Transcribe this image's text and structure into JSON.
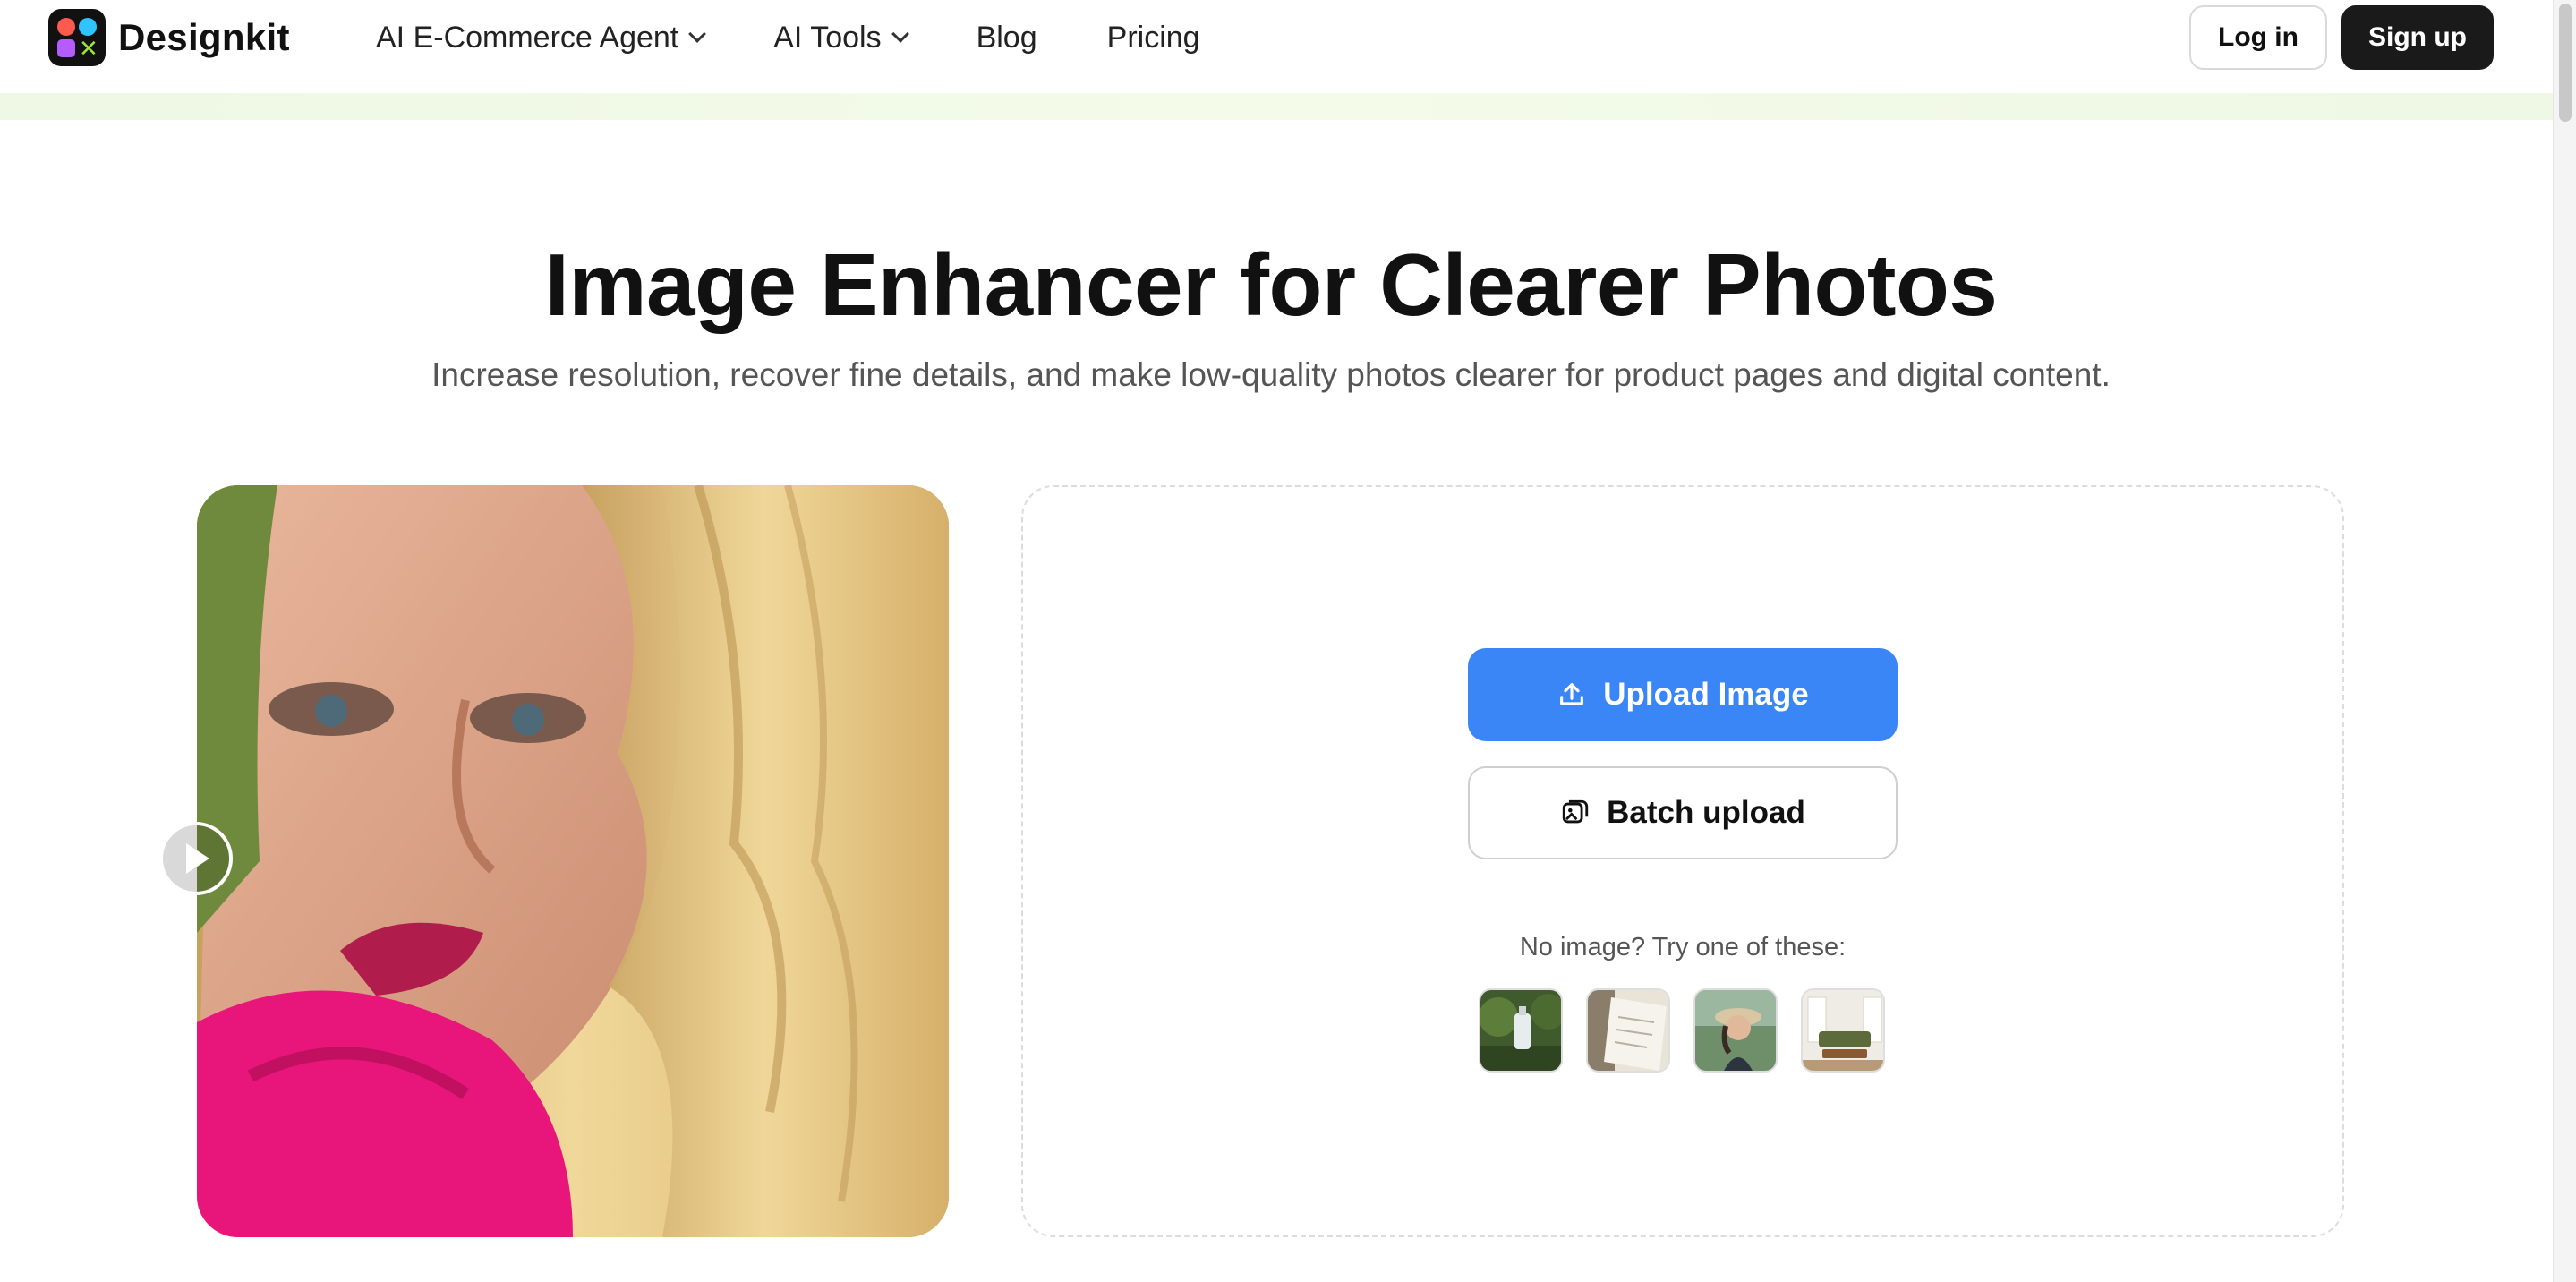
{
  "header": {
    "logo_text": "Designkit",
    "nav": [
      {
        "label": "AI E-Commerce Agent",
        "has_dropdown": true
      },
      {
        "label": "AI Tools",
        "has_dropdown": true
      },
      {
        "label": "Blog",
        "has_dropdown": false
      },
      {
        "label": "Pricing",
        "has_dropdown": false
      }
    ],
    "login_label": "Log in",
    "signup_label": "Sign up"
  },
  "hero": {
    "title": "Image Enhancer for Clearer Photos",
    "subtitle": "Increase resolution, recover fine details, and make low-quality photos clearer for product pages and digital content."
  },
  "upload": {
    "upload_label": "Upload Image",
    "batch_label": "Batch upload",
    "try_text": "No image? Try one of these:",
    "upload_icon": "upload-icon",
    "batch_icon": "batch-images-icon"
  },
  "colors": {
    "accent": "#3a86f7",
    "dark_button": "#1a1a1a",
    "header_band": "#eef8e4"
  }
}
